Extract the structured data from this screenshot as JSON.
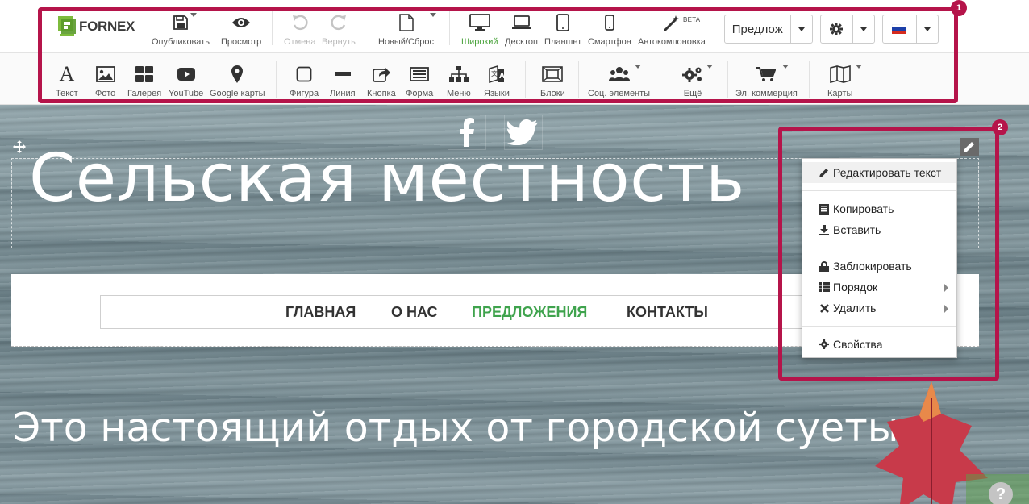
{
  "logo": {
    "text": "FORNEX"
  },
  "toolbar_top": {
    "publish": "Опубликовать",
    "preview": "Просмотр",
    "undo": "Отмена",
    "redo": "Вернуть",
    "new_reset": "Новый/Сброс",
    "wide": "Широкий",
    "desktop": "Десктоп",
    "tablet": "Планшет",
    "smartphone": "Смартфон",
    "autolayout": "Автокомпоновка",
    "beta": "BETA",
    "page_select": "Предлож"
  },
  "toolbar_bottom": {
    "text": "Текст",
    "photo": "Фото",
    "gallery": "Галерея",
    "youtube": "YouTube",
    "google_maps": "Google карты",
    "shape": "Фигура",
    "line": "Линия",
    "button": "Кнопка",
    "form": "Форма",
    "menu": "Меню",
    "languages": "Языки",
    "blocks": "Блоки",
    "social": "Соц. элементы",
    "more": "Ещё",
    "ecommerce": "Эл. коммерция",
    "maps": "Карты"
  },
  "annotations": {
    "badge1": "1",
    "badge2": "2"
  },
  "colors": {
    "accent_green": "#3fa34d",
    "frame_red": "#b5144a"
  },
  "page": {
    "title": "Сельская местность",
    "subtitle": "Это настоящий отдых от городской суеты",
    "nav": [
      "ГЛАВНАЯ",
      "О НАС",
      "ПРЕДЛОЖЕНИЯ",
      "КОНТАКТЫ"
    ],
    "help": "?"
  },
  "context_menu": {
    "edit_text": "Редактировать текст",
    "copy": "Копировать",
    "paste": "Вставить",
    "lock": "Заблокировать",
    "order": "Порядок",
    "delete": "Удалить",
    "properties": "Свойства"
  }
}
